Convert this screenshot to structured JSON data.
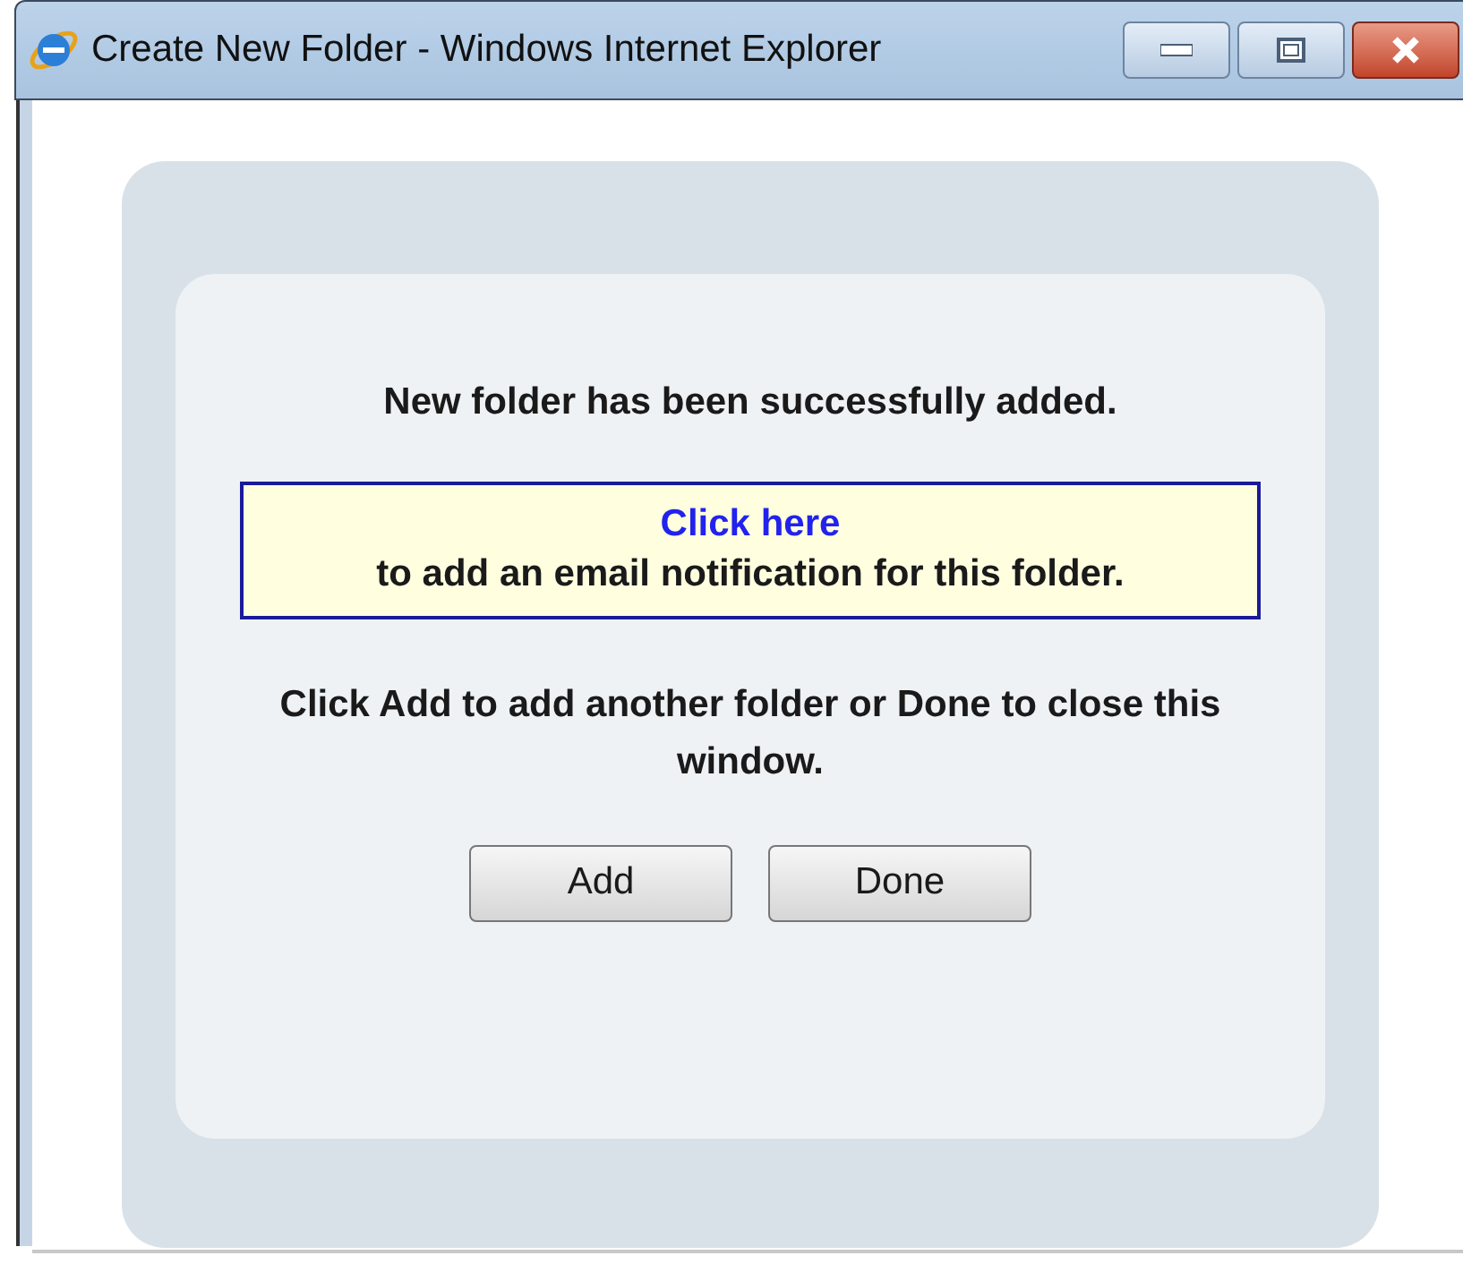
{
  "window": {
    "title": "Create New Folder - Windows Internet Explorer"
  },
  "message": "New folder has been successfully added.",
  "notice": {
    "link": "Click here",
    "text": "to add an email notification for this folder."
  },
  "instructions": "Click Add to add another folder or Done to close this window.",
  "buttons": [
    "Add",
    "Done"
  ]
}
